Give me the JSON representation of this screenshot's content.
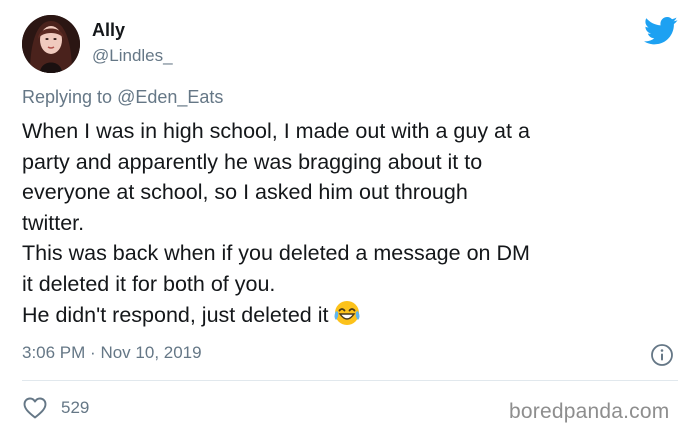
{
  "author": {
    "display_name": "Ally",
    "handle": "@Lindles_"
  },
  "reply": {
    "prefix": "Replying to",
    "to_handle": "@Eden_Eats"
  },
  "tweet": {
    "lines": [
      "When I was in high school, I made out with a guy at a",
      "party and apparently he was bragging about it to",
      "everyone at school, so I asked him out through",
      "twitter.",
      "This was back when if you deleted a message on DM",
      "it deleted it for both of you.",
      "He didn't respond, just deleted it"
    ],
    "emoji": "face-with-tears-of-joy-icon"
  },
  "meta": {
    "time": "3:06 PM",
    "separator": "·",
    "date": "Nov 10, 2019",
    "likes": "529"
  },
  "watermark": "boredpanda.com",
  "colors": {
    "twitter_blue": "#1da1f2",
    "secondary_text": "#657786",
    "primary_text": "#14171a",
    "divider": "#e1e8ed"
  },
  "icons": [
    "twitter-bird-icon",
    "info-icon",
    "heart-icon",
    "face-with-tears-of-joy-icon"
  ]
}
